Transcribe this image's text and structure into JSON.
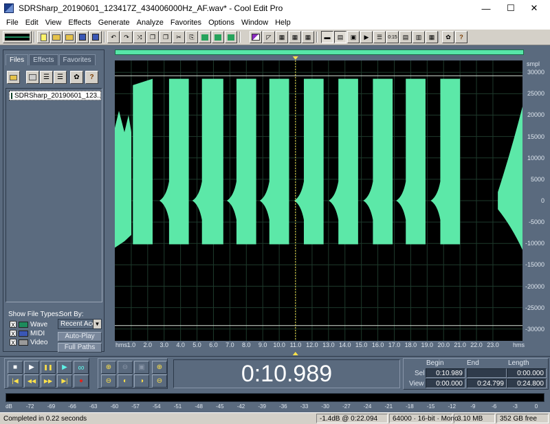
{
  "window": {
    "title": "SDRSharp_20190601_123417Z_434006000Hz_AF.wav* - Cool Edit Pro",
    "minimize_glyph": "—",
    "maximize_glyph": "☐",
    "close_glyph": "✕"
  },
  "menu": [
    "File",
    "Edit",
    "View",
    "Effects",
    "Generate",
    "Analyze",
    "Favorites",
    "Options",
    "Window",
    "Help"
  ],
  "organizer": {
    "tabs": [
      "Files",
      "Effects",
      "Favorites"
    ],
    "active_tab": "Files",
    "files": [
      "SDRSharp_20190601_123..."
    ],
    "show_file_types_label": "Show File Types:",
    "file_types": [
      {
        "label": "Wave",
        "checked": "X"
      },
      {
        "label": "MIDI",
        "checked": "X"
      },
      {
        "label": "Video",
        "checked": "X"
      }
    ],
    "sort_by_label": "Sort By:",
    "sort_value": "Recent Acc",
    "auto_play_label": "Auto-Play",
    "full_paths_label": "Full Paths"
  },
  "waveform": {
    "color": "#5ce8a8",
    "background": "#000000",
    "amplitude_unit": "smpl",
    "amplitude_ticks": [
      "30000",
      "25000",
      "20000",
      "15000",
      "10000",
      "5000",
      "0",
      "-5000",
      "-10000",
      "-15000",
      "-20000",
      "-25000",
      "-30000"
    ],
    "time_unit": "hms",
    "time_ticks": [
      "1.0",
      "2.0",
      "3.0",
      "4.0",
      "5.0",
      "6.0",
      "7.0",
      "8.0",
      "9.0",
      "10.0",
      "11.0",
      "12.0",
      "13.0",
      "14.0",
      "15.0",
      "16.0",
      "17.0",
      "18.0",
      "19.0",
      "20.0",
      "21.0",
      "22.0",
      "23.0"
    ],
    "view_start_s": 0.0,
    "view_end_s": 24.8,
    "cursor_s": 10.989,
    "bursts": [
      {
        "start_s": 0.0,
        "end_s": 1.1
      },
      {
        "start_s": 1.1,
        "end_s": 2.3
      },
      {
        "start_s": 3.3,
        "end_s": 4.5
      },
      {
        "start_s": 5.3,
        "end_s": 6.6
      },
      {
        "start_s": 7.4,
        "end_s": 8.6
      },
      {
        "start_s": 9.4,
        "end_s": 10.6
      },
      {
        "start_s": 11.5,
        "end_s": 12.7
      },
      {
        "start_s": 13.6,
        "end_s": 14.8
      },
      {
        "start_s": 15.7,
        "end_s": 16.9
      },
      {
        "start_s": 17.7,
        "end_s": 18.9
      },
      {
        "start_s": 19.8,
        "end_s": 21.0
      },
      {
        "start_s": 23.3,
        "end_s": 24.8
      }
    ]
  },
  "transport": {
    "time_display": "0:10.989",
    "buttons": {
      "stop": "■",
      "pause": "❚❚",
      "play": "▶",
      "play_loop": "∞",
      "goto_start": "|◀",
      "rewind": "◀◀",
      "fast_forward": "▶▶",
      "goto_end": "▶|",
      "record": "●"
    }
  },
  "selection": {
    "headers": {
      "begin": "Begin",
      "end": "End",
      "length": "Length"
    },
    "sel_label": "Sel",
    "view_label": "View",
    "sel_begin": "0:10.989",
    "sel_end": "",
    "sel_length": "0:00.000",
    "view_begin": "0:00.000",
    "view_end": "0:24.799",
    "view_length": "0:24.800"
  },
  "meter": {
    "labels": [
      "dB",
      "-72",
      "-69",
      "-66",
      "-63",
      "-60",
      "-57",
      "-54",
      "-51",
      "-48",
      "-45",
      "-42",
      "-39",
      "-36",
      "-33",
      "-30",
      "-27",
      "-24",
      "-21",
      "-18",
      "-15",
      "-12",
      "-9",
      "-6",
      "-3",
      "0"
    ]
  },
  "status": {
    "message": "Completed in 0.22 seconds",
    "level": "-1.4dB @  0:22.094",
    "format": "64000 · 16-bit · Mono",
    "size": "3.10 MB",
    "free": "352 GB free"
  }
}
